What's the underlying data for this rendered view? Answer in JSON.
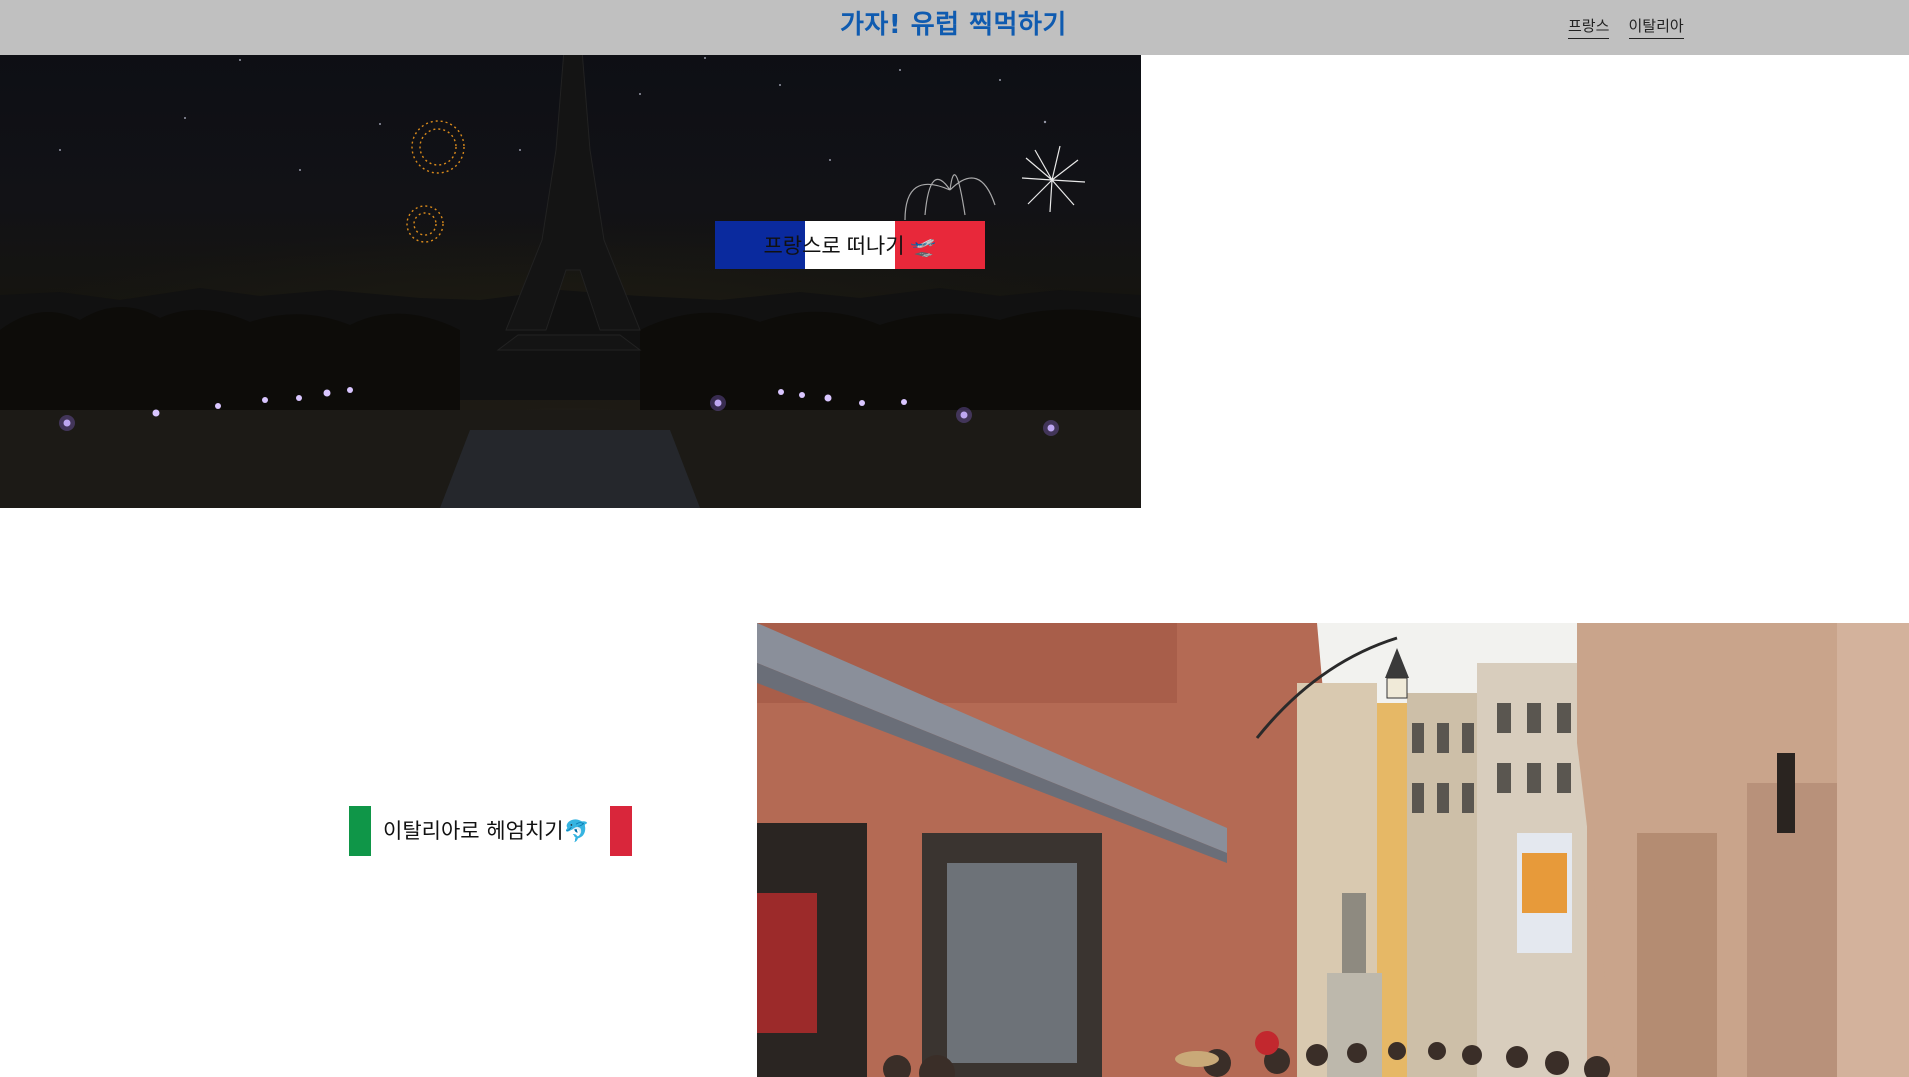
{
  "header": {
    "title": "가자! 유럽 찍먹하기",
    "nav": [
      {
        "label": "프랑스"
      },
      {
        "label": "이탈리아"
      }
    ]
  },
  "france": {
    "button_label": "프랑스로 떠나기 🛫",
    "flag_colors": [
      "#0a2a9e",
      "#ffffff",
      "#e8283a"
    ]
  },
  "italy": {
    "button_label": "이탈리아로 헤엄치기🐬",
    "flag_colors": [
      "#0f9648",
      "#ffffff",
      "#d9263b"
    ]
  },
  "colors": {
    "header_bg": "#c0c0c0",
    "title": "#0f5bb0"
  }
}
